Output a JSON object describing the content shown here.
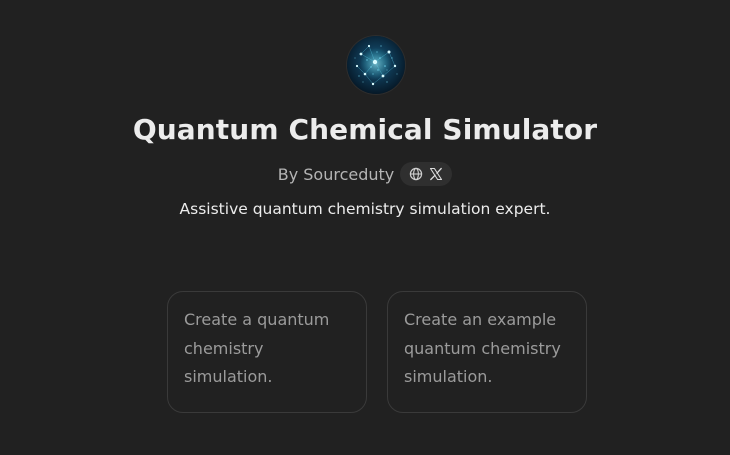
{
  "gpt": {
    "avatar_icon": "quantum-particles-avatar",
    "title": "Quantum Chemical Simulator",
    "author": "By Sourceduty",
    "link_icons": [
      "globe-icon",
      "x-logo-icon"
    ],
    "description": "Assistive quantum chemistry simulation expert."
  },
  "starters": [
    {
      "text": "Create a quantum chemistry simulation."
    },
    {
      "text": "Create an example quantum chemistry simulation."
    }
  ],
  "colors": {
    "background": "#212121",
    "title": "#ececec",
    "muted": "#b4b4b4",
    "card_border": "#3a3a3a",
    "card_text": "#9b9b9b"
  }
}
